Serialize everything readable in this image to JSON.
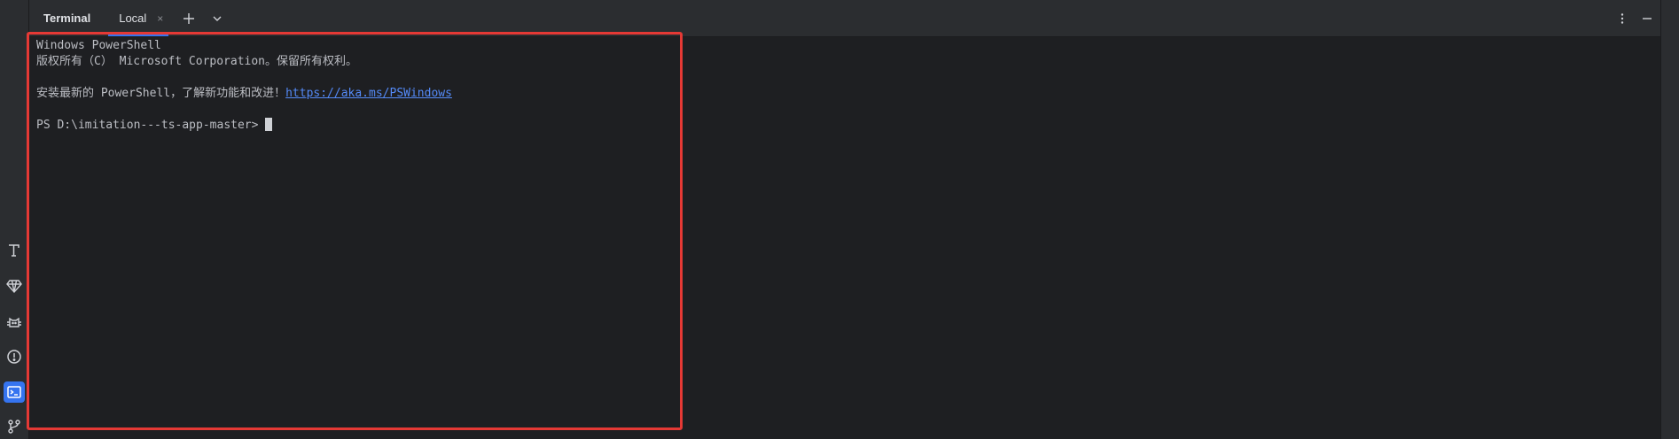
{
  "header": {
    "title": "Terminal",
    "tabs": [
      {
        "label": "Local",
        "close": "×"
      }
    ],
    "new_tab_icon": "plus-icon",
    "dropdown_icon": "chevron-down-icon",
    "more_icon": "more-vertical-icon",
    "minimize_icon": "minimize-icon"
  },
  "left_strip": {
    "icons": [
      "text-tool-icon",
      "gem-icon",
      "cat-icon",
      "problems-icon",
      "terminal-icon",
      "git-branch-icon"
    ],
    "active": "terminal-icon"
  },
  "terminal": {
    "line1": "Windows PowerShell",
    "line2": "版权所有（C） Microsoft Corporation。保留所有权利。",
    "line3_text": "安装最新的 PowerShell，了解新功能和改进！",
    "line3_link": "https://aka.ms/PSWindows",
    "prompt": "PS D:\\imitation---ts-app-master>"
  },
  "colors": {
    "background": "#1e1f22",
    "panel": "#2b2d30",
    "accent": "#3574f0",
    "text": "#bcbec4",
    "link": "#548af7",
    "highlight": "#e53935"
  }
}
